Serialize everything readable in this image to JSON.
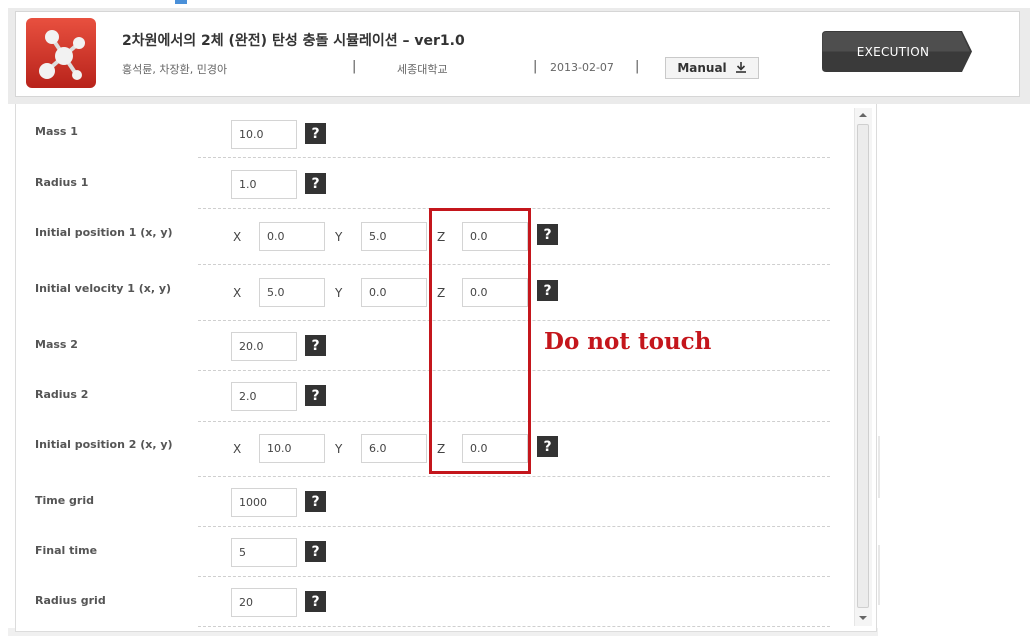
{
  "header": {
    "title": "2차원에서의 2체 (완전) 탄성 충돌 시뮬레이션  – ver1.0",
    "authors": "홍석륜, 차장환, 민경아",
    "separator": "|",
    "institution": "세종대학교",
    "date": "2013-02-07",
    "manual_label": "Manual",
    "manual_icon": "download-icon",
    "execute_label": "EXECUTION",
    "logo_icon": "molecule-icon"
  },
  "form": {
    "help_label": "?",
    "axis": {
      "x": "X",
      "y": "Y",
      "z": "Z"
    },
    "rows": [
      {
        "label": "Mass 1",
        "value": "10.0"
      },
      {
        "label": "Radius 1",
        "value": "1.0"
      },
      {
        "label": "Initial position 1 (x, y)",
        "x": "0.0",
        "y": "5.0",
        "z": "0.0"
      },
      {
        "label": "Initial velocity 1 (x, y)",
        "x": "5.0",
        "y": "0.0",
        "z": "0.0"
      },
      {
        "label": "Mass 2",
        "value": "20.0"
      },
      {
        "label": "Radius 2",
        "value": "2.0"
      },
      {
        "label": "Initial position 2 (x, y)",
        "x": "10.0",
        "y": "6.0",
        "z": "0.0"
      },
      {
        "label": "Time grid",
        "value": "1000"
      },
      {
        "label": "Final time",
        "value": "5"
      },
      {
        "label": "Radius grid",
        "value": "20"
      }
    ]
  },
  "annotation": {
    "text": "Do not touch",
    "color": "#c4161c"
  },
  "colors": {
    "execute_bg": "#3a3a3a",
    "help_bg": "#333333",
    "logo_red": "#d0392d"
  }
}
